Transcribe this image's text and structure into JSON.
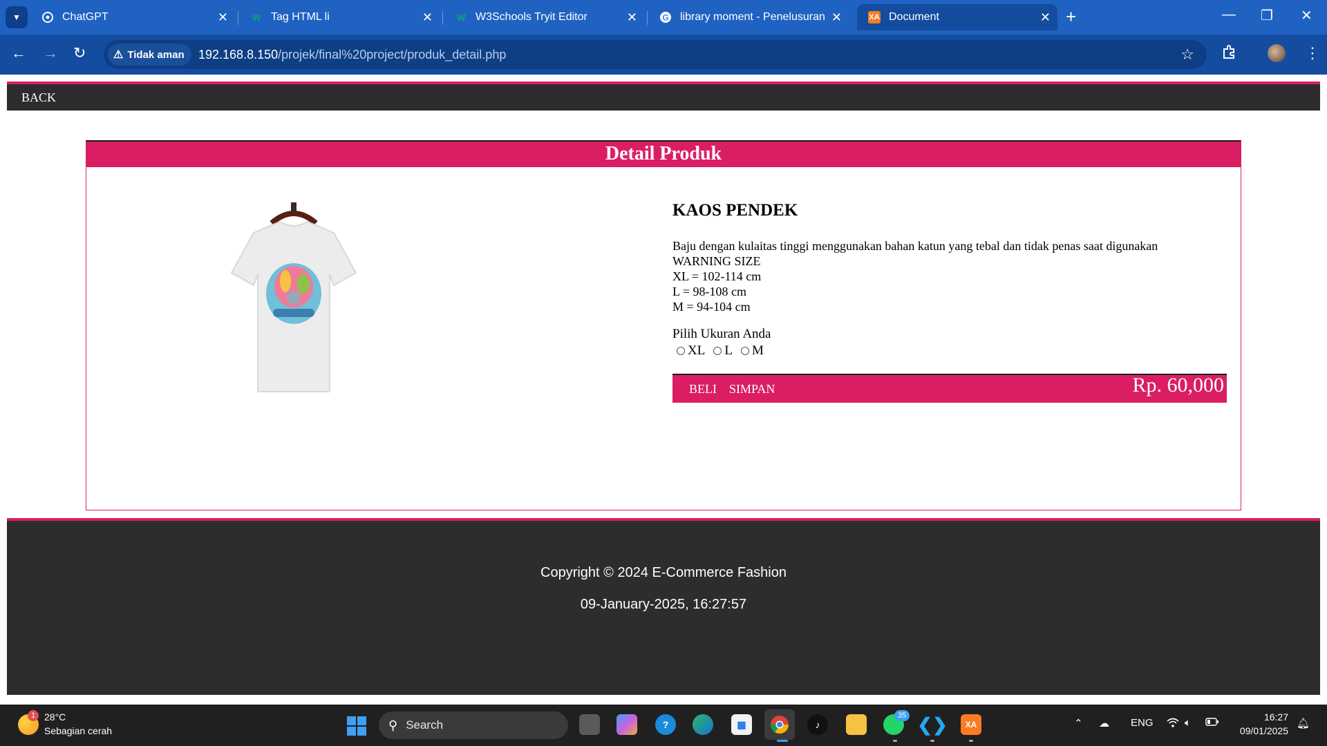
{
  "browser": {
    "tabs": [
      {
        "title": "ChatGPT",
        "icon": "chatgpt-icon"
      },
      {
        "title": "Tag HTML li",
        "icon": "w3schools-icon"
      },
      {
        "title": "W3Schools Tryit Editor",
        "icon": "w3schools-icon"
      },
      {
        "title": "library moment - Penelusuran G",
        "icon": "google-icon"
      },
      {
        "title": "Document",
        "icon": "xampp-icon",
        "active": true
      }
    ],
    "security_label": "Tidak aman",
    "url_host": "192.168.8.150",
    "url_path": "/projek/final%20project/produk_detail.php"
  },
  "page": {
    "back_label": "BACK",
    "card_title": "Detail Produk",
    "product": {
      "name": "KAOS PENDEK",
      "description": "Baju dengan kulaitas tinggi menggunakan bahan katun yang tebal dan tidak penas saat digunakan",
      "size_lines": [
        "WARNING SIZE",
        "XL = 102-114 cm",
        "L = 98-108 cm",
        "M = 94-104 cm"
      ],
      "size_prompt": "Pilih Ukuran Anda",
      "sizes": [
        "XL",
        "L",
        "M"
      ],
      "buy_label": "BELI",
      "save_label": "SIMPAN",
      "price": "Rp. 60,000"
    },
    "footer": {
      "copyright": "Copyright © 2024 E-Commerce Fashion",
      "datetime": "09-January-2025, 16:27:57"
    }
  },
  "taskbar": {
    "weather_badge": "1",
    "temperature": "28°C",
    "condition": "Sebagian cerah",
    "search_placeholder": "Search",
    "whatsapp_badge": "35",
    "language": "ENG",
    "time": "16:27",
    "date": "09/01/2025"
  },
  "colors": {
    "accent": "#db1e64",
    "dark_bar": "#2e2c2e",
    "chrome_blue": "#1f62c2"
  }
}
